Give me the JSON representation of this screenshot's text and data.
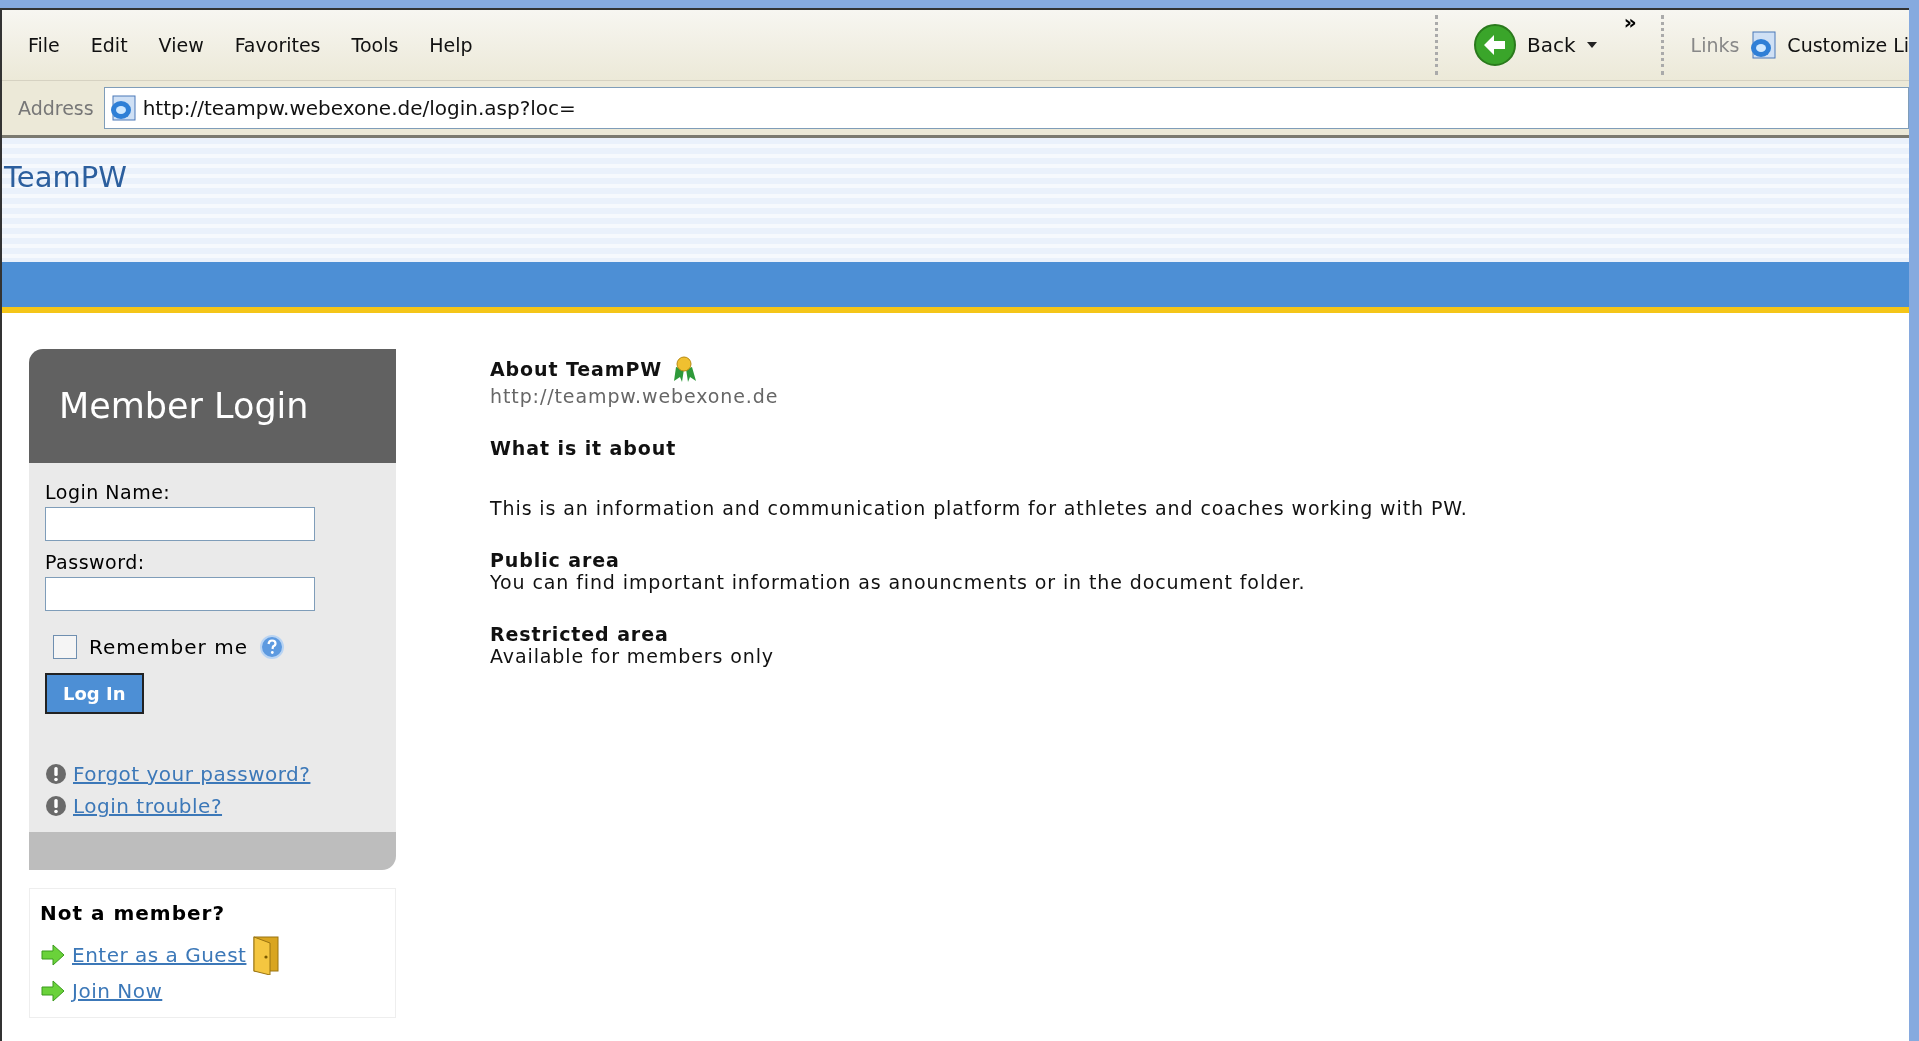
{
  "menu_bar": {
    "items": [
      "File",
      "Edit",
      "View",
      "Favorites",
      "Tools",
      "Help"
    ]
  },
  "toolbar": {
    "back_button": "Back",
    "chevron": "»"
  },
  "links_bar": {
    "label": "Links",
    "item": "Customize Li"
  },
  "address_bar": {
    "label": "Address",
    "value": "http://teampw.webexone.de/login.asp?loc="
  },
  "site": {
    "title": "TeamPW"
  },
  "login": {
    "title": "Member Login",
    "fields": [
      {
        "label": "Login Name:"
      },
      {
        "label": "Password:"
      }
    ],
    "remember": {
      "label": "Remember me",
      "checked": false
    },
    "submit": "Log In",
    "links": [
      "Forgot your password?",
      "Login trouble?"
    ]
  },
  "guest": {
    "title": "Not a member?",
    "links": [
      "Enter as a Guest",
      "Join Now"
    ]
  },
  "about": {
    "title": "About TeamPW",
    "url": "http://teampw.webexone.de",
    "sections": [
      {
        "heading": "What is it about",
        "text": "This is an information and communication platform for athletes and coaches working with PW."
      },
      {
        "heading": "Public area",
        "text": "You can find important information as anouncments or in the document folder."
      },
      {
        "heading": "Restricted area",
        "text": "Available for members only"
      }
    ]
  }
}
